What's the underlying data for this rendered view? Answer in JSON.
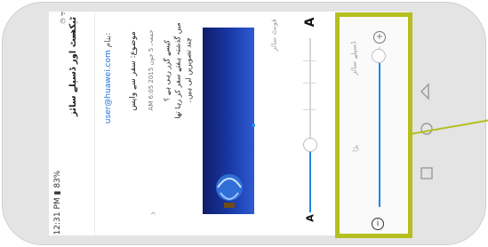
{
  "status_bar": {
    "time": "12:31 PM",
    "battery": "83%"
  },
  "header": {
    "title": "ٹیکسٹ اور ڈسپلے سائز",
    "back_icon": "arrow-right-icon"
  },
  "email": {
    "to": "user@huawei.com",
    "to_label": "بنام:",
    "subject": "موضوع: سفر سے واپس",
    "date": "AM 6:05 2015 جمعہ، 5 جون",
    "body_lines": [
      "کیسے گزر رہی ہے ؟",
      "میں گذشتہ ہفتے سفر کر رہا تھا",
      "چند تصویریں لی ہیں۔"
    ]
  },
  "font_size": {
    "label": "فونٹ سائز",
    "small_icon": "A",
    "large_icon": "A",
    "level": 0.28
  },
  "display_size": {
    "label": "ڈسپلے سائز",
    "level": 0.92,
    "zoom_in_icon": "plus-circle-icon",
    "info_icon": "info-icon",
    "reset_label": "پڑا"
  },
  "navigation": {
    "back": "triangle-back-icon",
    "home": "circle-home-icon",
    "recent": "square-recent-icon"
  },
  "colors": {
    "accent": "#1e88e5",
    "highlight": "#b5bf1f"
  }
}
